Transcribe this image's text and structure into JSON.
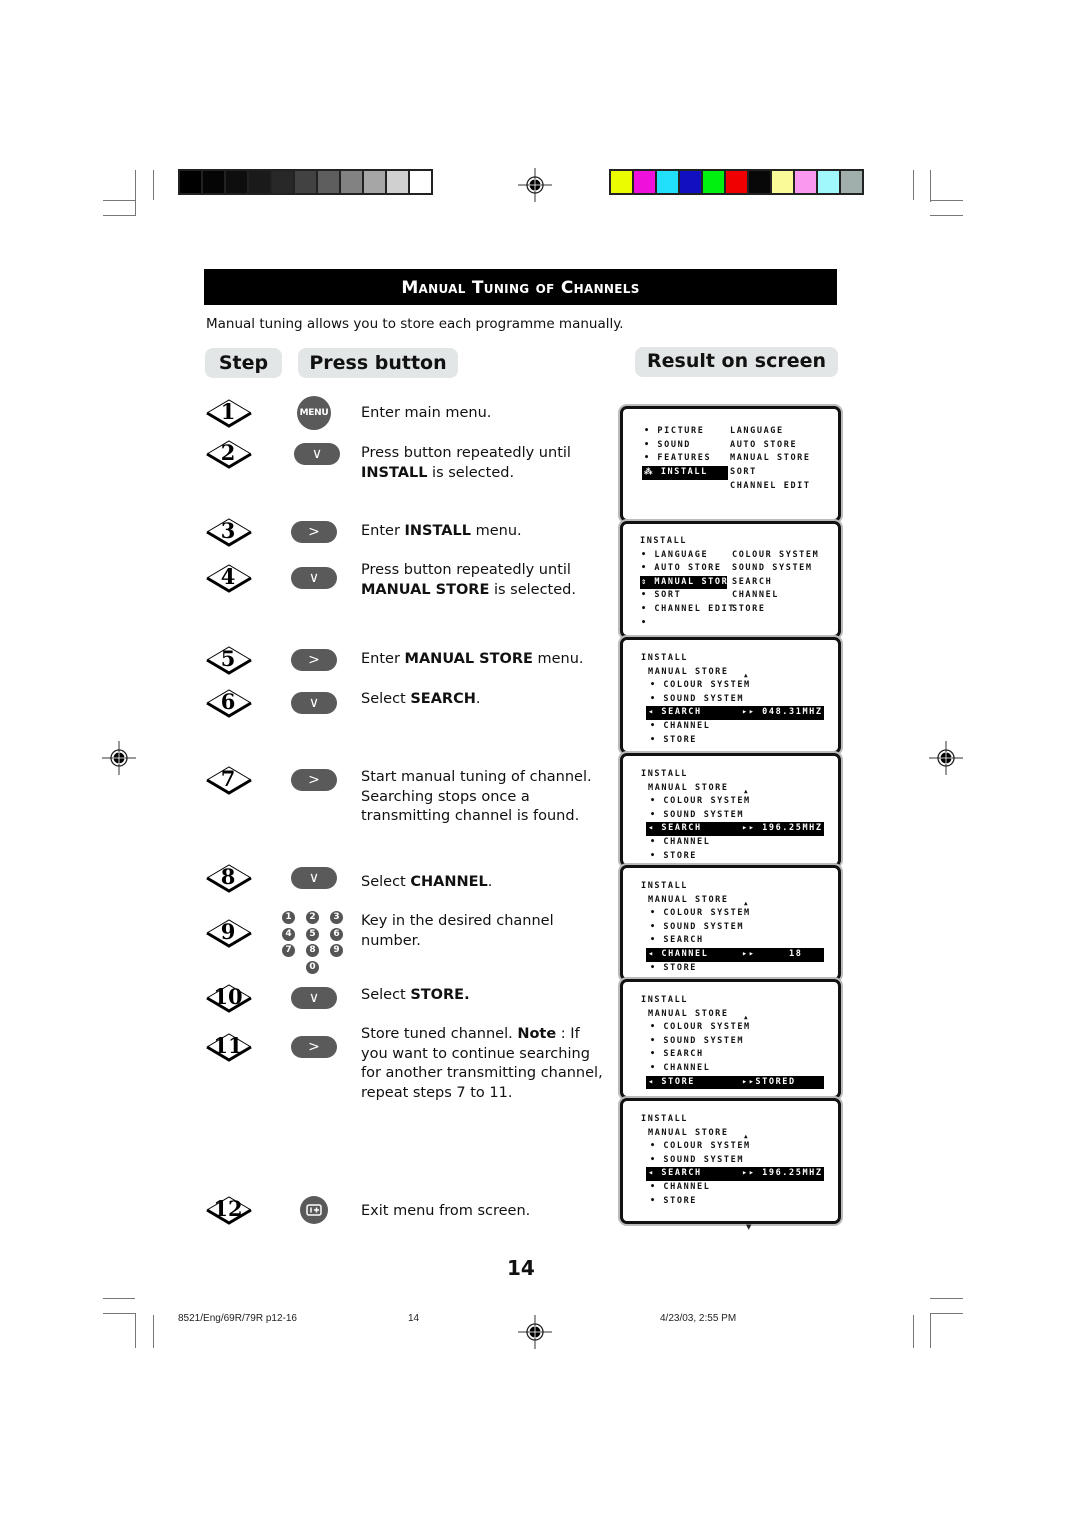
{
  "color_bars": {
    "grayscale": [
      "#000000",
      "#050505",
      "#0e0e0e",
      "#1a1a1a",
      "#282828",
      "#424242",
      "#5e5e5e",
      "#828282",
      "#a6a6a6",
      "#d0d0d0",
      "#ffffff"
    ],
    "colors": [
      "#ecfc00",
      "#f010dc",
      "#20e0fc",
      "#1010c0",
      "#00f010",
      "#f00000",
      "#080808",
      "#fafa98",
      "#fa98f0",
      "#a0f8fc",
      "#a0aeac"
    ]
  },
  "header": {
    "title": "Manual Tuning of Channels",
    "intro": "Manual tuning allows you to store each programme manually."
  },
  "columns": {
    "step": "Step",
    "press_button": "Press button",
    "result": "Result on screen"
  },
  "steps": [
    {
      "num": "1",
      "button": "menu-button",
      "button_label": "MENU",
      "text_parts": [
        {
          "t": "Enter main menu.",
          "b": false
        }
      ]
    },
    {
      "num": "2",
      "button": "down-button",
      "button_label": "∨",
      "text_parts": [
        {
          "t": "Press button repeatedly until ",
          "b": false
        },
        {
          "t": "INSTALL",
          "b": true
        },
        {
          "t": " is selected.",
          "b": false
        }
      ]
    },
    {
      "num": "3",
      "button": "right-button",
      "button_label": ">",
      "text_parts": [
        {
          "t": "Enter ",
          "b": false
        },
        {
          "t": "INSTALL",
          "b": true
        },
        {
          "t": " menu.",
          "b": false
        }
      ]
    },
    {
      "num": "4",
      "button": "down-button",
      "button_label": "∨",
      "text_parts": [
        {
          "t": "Press button repeatedly until ",
          "b": false
        },
        {
          "t": "MANUAL STORE",
          "b": true
        },
        {
          "t": " is selected.",
          "b": false
        }
      ]
    },
    {
      "num": "5",
      "button": "right-button",
      "button_label": ">",
      "text_parts": [
        {
          "t": "Enter ",
          "b": false
        },
        {
          "t": "MANUAL STORE",
          "b": true
        },
        {
          "t": " menu.",
          "b": false
        }
      ]
    },
    {
      "num": "6",
      "button": "down-button",
      "button_label": "∨",
      "text_parts": [
        {
          "t": "Select ",
          "b": false
        },
        {
          "t": "SEARCH",
          "b": true
        },
        {
          "t": ".",
          "b": false
        }
      ]
    },
    {
      "num": "7",
      "button": "right-button",
      "button_label": ">",
      "text_parts": [
        {
          "t": "Start manual tuning of channel. Searching stops once a transmitting channel is found.",
          "b": false
        }
      ]
    },
    {
      "num": "8",
      "button": "down-button",
      "button_label": "∨",
      "text_parts": [
        {
          "t": "Select ",
          "b": false
        },
        {
          "t": "CHANNEL",
          "b": true
        },
        {
          "t": ".",
          "b": false
        }
      ]
    },
    {
      "num": "9",
      "button": "number-keys",
      "button_label": "",
      "text_parts": [
        {
          "t": "Key in the desired channel number.",
          "b": false
        }
      ]
    },
    {
      "num": "10",
      "button": "down-button",
      "button_label": "∨",
      "text_parts": [
        {
          "t": "Select ",
          "b": false
        },
        {
          "t": "STORE.",
          "b": true
        }
      ]
    },
    {
      "num": "11",
      "button": "right-button",
      "button_label": ">",
      "text_parts": [
        {
          "t": "Store tuned  channel. ",
          "b": false
        },
        {
          "t": "Note",
          "b": true
        },
        {
          "t": " : If you want to continue searching for another transmitting channel, repeat steps 7 to 11.",
          "b": false
        }
      ]
    },
    {
      "num": "12",
      "button": "osd-exit-button",
      "button_label": "",
      "text_parts": [
        {
          "t": "Exit menu from screen.",
          "b": false
        }
      ]
    }
  ],
  "keypad": [
    "1",
    "2",
    "3",
    "4",
    "5",
    "6",
    "7",
    "8",
    "9",
    "0"
  ],
  "screens": [
    {
      "rows": [
        {
          "left": "• PICTURE",
          "right": "LANGUAGE",
          "hl": false
        },
        {
          "left": "• SOUND",
          "right": "AUTO STORE",
          "hl": false
        },
        {
          "left": "• FEATURES",
          "right": "MANUAL STORE",
          "hl": false
        },
        {
          "left": "⁂ INSTALL",
          "right": "SORT",
          "hl": true
        },
        {
          "left": "",
          "right": "CHANNEL EDIT",
          "hl": false
        }
      ]
    },
    {
      "title": "INSTALL",
      "rows": [
        {
          "left": "• LANGUAGE",
          "right": "COLOUR SYSTEM",
          "hl": false
        },
        {
          "left": "• AUTO STORE",
          "right": "SOUND SYSTEM",
          "hl": false
        },
        {
          "left": "⇕ MANUAL STORE",
          "right": "SEARCH",
          "hl": true
        },
        {
          "left": "• SORT",
          "right": "CHANNEL",
          "hl": false
        },
        {
          "left": "• CHANNEL EDIT",
          "right": "STORE",
          "hl": false
        },
        {
          "left": "•",
          "right": "",
          "hl": false
        }
      ]
    },
    {
      "title": "INSTALL",
      "subtitle": "MANUAL STORE",
      "rows": [
        {
          "label": "• COLOUR SYSTEM",
          "value": "",
          "hl": false
        },
        {
          "label": "• SOUND SYSTEM",
          "value": "",
          "hl": false
        },
        {
          "label": "◂ SEARCH",
          "value": "▸▸ 048.31MHZ",
          "hl": true
        },
        {
          "label": "• CHANNEL",
          "value": "",
          "hl": false
        },
        {
          "label": "• STORE",
          "value": "",
          "hl": false
        }
      ]
    },
    {
      "title": "INSTALL",
      "subtitle": "MANUAL STORE",
      "rows": [
        {
          "label": "• COLOUR SYSTEM",
          "value": "",
          "hl": false
        },
        {
          "label": "• SOUND SYSTEM",
          "value": "",
          "hl": false
        },
        {
          "label": "◂ SEARCH",
          "value": "▸▸ 196.25MHZ",
          "hl": true
        },
        {
          "label": "• CHANNEL",
          "value": "",
          "hl": false
        },
        {
          "label": "• STORE",
          "value": "",
          "hl": false
        }
      ]
    },
    {
      "title": "INSTALL",
      "subtitle": "MANUAL STORE",
      "rows": [
        {
          "label": "• COLOUR SYSTEM",
          "value": "",
          "hl": false
        },
        {
          "label": "• SOUND SYSTEM",
          "value": "",
          "hl": false
        },
        {
          "label": "• SEARCH",
          "value": "",
          "hl": false
        },
        {
          "label": "◂ CHANNEL",
          "value": "▸▸     18",
          "hl": true
        },
        {
          "label": "• STORE",
          "value": "",
          "hl": false
        }
      ]
    },
    {
      "title": "INSTALL",
      "subtitle": "MANUAL STORE",
      "rows": [
        {
          "label": "• COLOUR SYSTEM",
          "value": "",
          "hl": false
        },
        {
          "label": "• SOUND SYSTEM",
          "value": "",
          "hl": false
        },
        {
          "label": "• SEARCH",
          "value": "",
          "hl": false
        },
        {
          "label": "• CHANNEL",
          "value": "",
          "hl": false
        },
        {
          "label": "◂ STORE",
          "value": "▸▸STORED",
          "hl": true
        }
      ]
    },
    {
      "title": "INSTALL",
      "subtitle": "MANUAL STORE",
      "rows": [
        {
          "label": "• COLOUR SYSTEM",
          "value": "",
          "hl": false
        },
        {
          "label": "• SOUND SYSTEM",
          "value": "",
          "hl": false
        },
        {
          "label": "◂ SEARCH",
          "value": "▸▸ 196.25MHZ",
          "hl": true
        },
        {
          "label": "• CHANNEL",
          "value": "",
          "hl": false
        },
        {
          "label": "• STORE",
          "value": "",
          "hl": false
        }
      ]
    }
  ],
  "page_number": "14",
  "footer": {
    "file": "8521/Eng/69R/79R p12-16",
    "page": "14",
    "date": "4/23/03, 2:55 PM"
  }
}
